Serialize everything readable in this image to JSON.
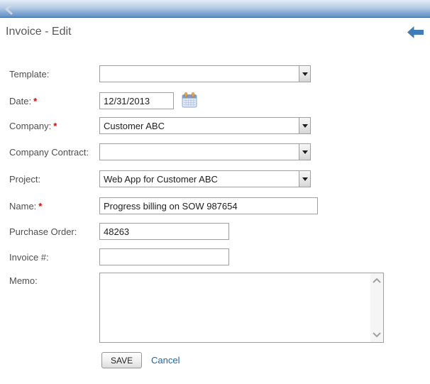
{
  "header": {
    "title": "Invoice - Edit"
  },
  "form": {
    "required_marker": "*",
    "template": {
      "label": "Template:",
      "value": "",
      "required": false
    },
    "date": {
      "label": "Date:",
      "value": "12/31/2013",
      "required": true
    },
    "company": {
      "label": "Company:",
      "value": "Customer ABC",
      "required": true
    },
    "company_contract": {
      "label": "Company Contract:",
      "value": "",
      "required": false
    },
    "project": {
      "label": "Project:",
      "value": "Web App for Customer ABC",
      "required": false
    },
    "name": {
      "label": "Name:",
      "value": "Progress billing on SOW 987654",
      "required": true
    },
    "purchase_order": {
      "label": "Purchase Order:",
      "value": "48263",
      "required": false
    },
    "invoice_number": {
      "label": "Invoice #:",
      "value": "",
      "required": false
    },
    "memo": {
      "label": "Memo:",
      "value": ""
    }
  },
  "footer": {
    "save_label": "SAVE",
    "cancel_label": "Cancel"
  },
  "icons": {
    "header_back": "chevron-left-icon",
    "title_back": "arrow-left-icon",
    "date_picker": "calendar-icon",
    "dropdown": "caret-down-icon",
    "memo_scroll_up": "chevron-up-icon",
    "memo_scroll_down": "chevron-down-icon"
  },
  "colors": {
    "header_gradient_top": "#e2ecf6",
    "header_gradient_bottom": "#6491c6",
    "header_border": "#30639e",
    "back_arrow_blue": "#3f7cb8",
    "link_blue": "#2166a5",
    "required_red": "#e00000",
    "title_text": "#595959",
    "label_text": "#4f4f4f",
    "input_border": "#9f9f9f"
  }
}
